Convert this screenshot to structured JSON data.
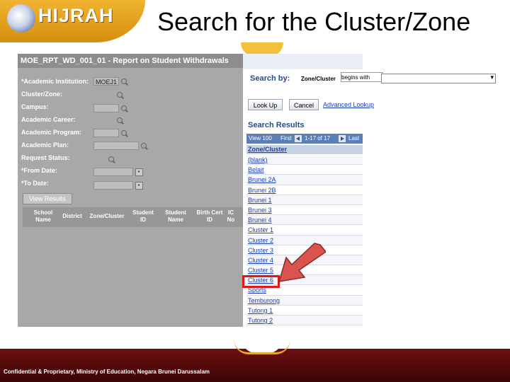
{
  "header": {
    "logo_text": "HIJRAH",
    "slide_title": "Search for the Cluster/Zone"
  },
  "report": {
    "title": "MOE_RPT_WD_001_01 - Report on Student Withdrawals",
    "fields": [
      {
        "label": "*Academic Institution:",
        "value": "MOEJ1"
      },
      {
        "label": "Cluster/Zone:",
        "value": ""
      },
      {
        "label": "Campus:",
        "value": ""
      },
      {
        "label": "Academic Career:",
        "value": ""
      },
      {
        "label": "Academic Program:",
        "value": ""
      },
      {
        "label": "Academic Plan:",
        "value": ""
      },
      {
        "label": "Request Status:",
        "value": ""
      },
      {
        "label": "*From Date:",
        "value": ""
      },
      {
        "label": "*To Date:",
        "value": ""
      }
    ],
    "view_results_label": "View Results",
    "grid_columns": [
      "School Name",
      "District",
      "Zone/Cluster",
      "Student ID",
      "Student Name",
      "Birth Cert ID",
      "IC No"
    ]
  },
  "lookup": {
    "search_by_label": "Search by:",
    "field_name": "Zone/Cluster",
    "operator": "begins with",
    "value": "",
    "lookup_button": "Look Up",
    "cancel_button": "Cancel",
    "advanced_link": "Advanced Lookup",
    "results_title": "Search Results",
    "nav": {
      "view_all": "View 100",
      "first": "First",
      "range": "1-17 of 17",
      "last": "Last"
    },
    "column_header": "Zone/Cluster",
    "results": [
      "(blank)",
      "Belait",
      "Brunei 2A",
      "Brunei 2B",
      "Brunei 1",
      "Brunei 3",
      "Brunei 4",
      "Cluster 1",
      "Cluster 2",
      "Cluster 3",
      "Cluster 4",
      "Cluster 5",
      "Cluster 6",
      "Sports",
      "Temburong",
      "Tutong 1",
      "Tutong 2"
    ],
    "highlighted_result": "Cluster 6"
  },
  "footer": {
    "text": "Confidential & Proprietary, Ministry of Education, Negara Brunei Darussalam"
  },
  "colors": {
    "footer": "#5a0a0a",
    "logo": "#e8a21a",
    "link": "#1a3fb0",
    "highlight": "#e01818",
    "arrow": "#d9534f"
  }
}
